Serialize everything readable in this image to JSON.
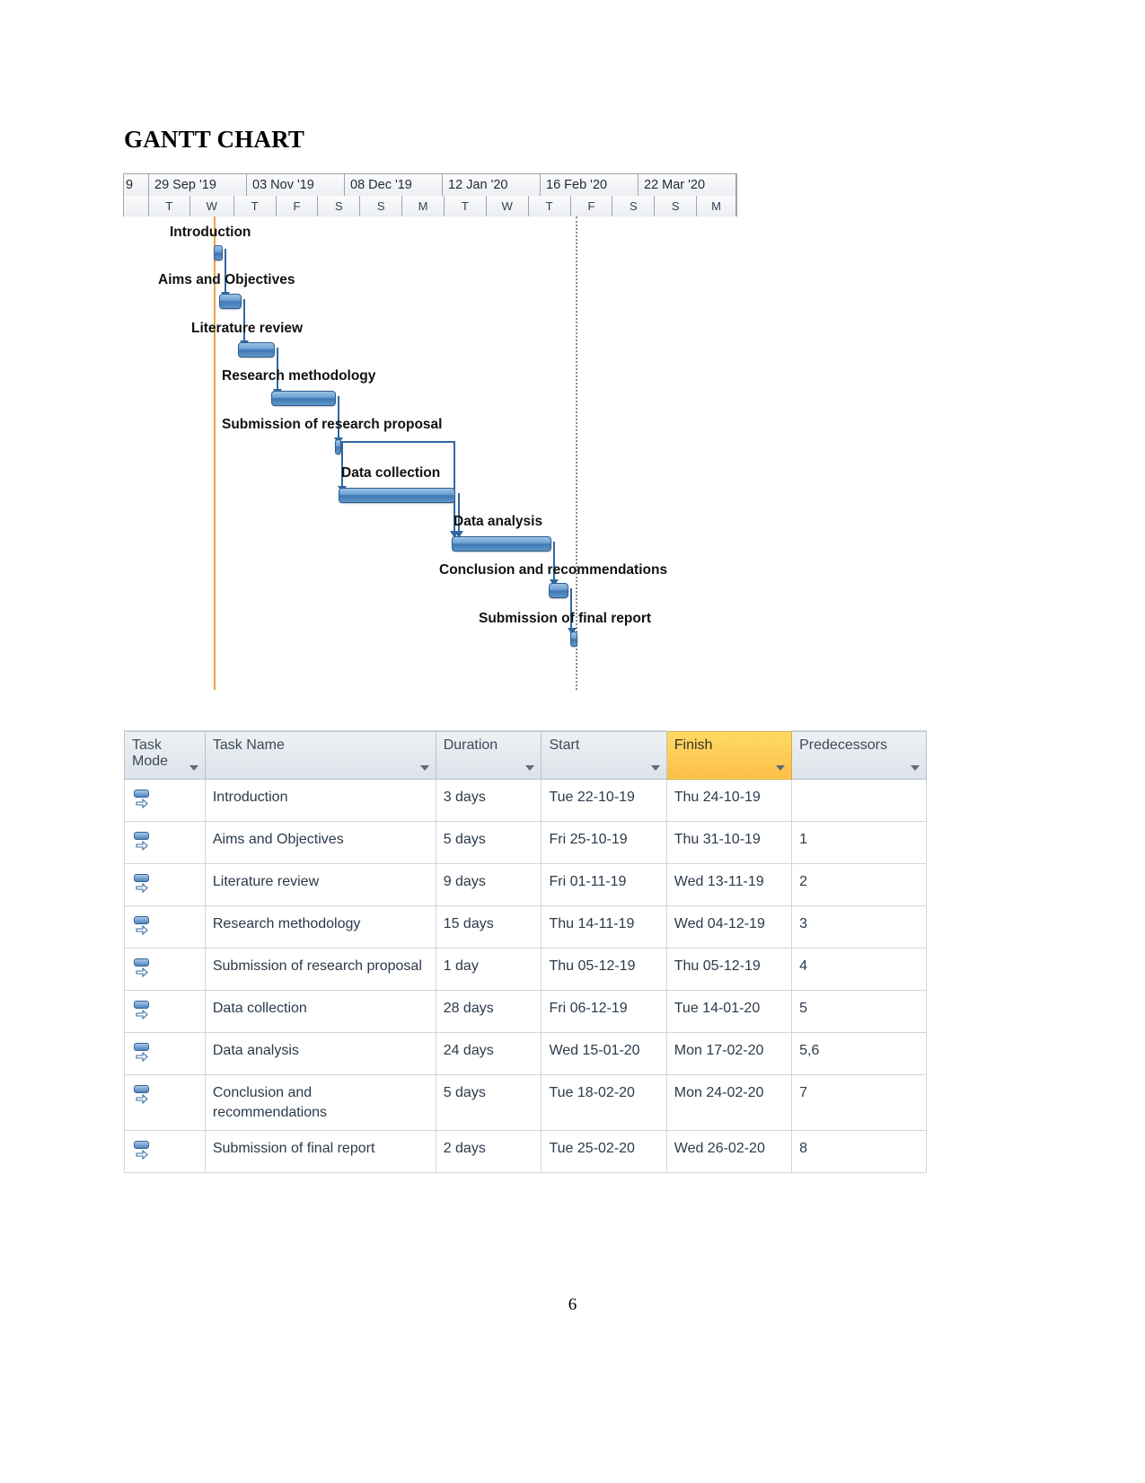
{
  "document": {
    "title": "GANTT CHART",
    "page_number": "6"
  },
  "gantt": {
    "timeline": {
      "period_labels": [
        "9",
        "29 Sep '19",
        "03 Nov '19",
        "08 Dec '19",
        "12 Jan '20",
        "16 Feb '20",
        "22 Mar '20"
      ],
      "day_labels": [
        "",
        "T",
        "W",
        "T",
        "F",
        "S",
        "S",
        "M",
        "T",
        "W",
        "T",
        "F",
        "S",
        "S",
        "M"
      ]
    },
    "bars": [
      {
        "label": "Introduction",
        "duration": "3 days"
      },
      {
        "label": "Aims and Objectives",
        "duration": "5 days"
      },
      {
        "label": "Literature review",
        "duration": "9 days"
      },
      {
        "label": "Research methodology",
        "duration": "15 days"
      },
      {
        "label": "Submission of research proposal",
        "duration": "1 day"
      },
      {
        "label": "Data collection",
        "duration": "28 days"
      },
      {
        "label": "Data analysis",
        "duration": "24 days"
      },
      {
        "label": "Conclusion and recommendations",
        "duration": "5 days"
      },
      {
        "label": "Submission of final report",
        "duration": "2 days"
      }
    ]
  },
  "table": {
    "headers": {
      "mode": "Task Mode",
      "name": "Task Name",
      "duration": "Duration",
      "start": "Start",
      "finish": "Finish",
      "predecessors": "Predecessors"
    },
    "rows": [
      {
        "mode_icon": "manually-scheduled-icon",
        "name": "Introduction",
        "duration": "3 days",
        "start": "Tue 22-10-19",
        "finish": "Thu 24-10-19",
        "predecessors": ""
      },
      {
        "mode_icon": "manually-scheduled-icon",
        "name": "Aims and Objectives",
        "duration": "5 days",
        "start": "Fri 25-10-19",
        "finish": "Thu 31-10-19",
        "predecessors": "1"
      },
      {
        "mode_icon": "manually-scheduled-icon",
        "name": "Literature review",
        "duration": "9 days",
        "start": "Fri 01-11-19",
        "finish": "Wed 13-11-19",
        "predecessors": "2"
      },
      {
        "mode_icon": "manually-scheduled-icon",
        "name": "Research methodology",
        "duration": "15 days",
        "start": "Thu 14-11-19",
        "finish": "Wed 04-12-19",
        "predecessors": "3"
      },
      {
        "mode_icon": "manually-scheduled-icon",
        "name": "Submission of research proposal",
        "duration": "1 day",
        "start": "Thu 05-12-19",
        "finish": "Thu 05-12-19",
        "predecessors": "4"
      },
      {
        "mode_icon": "manually-scheduled-icon",
        "name": "Data collection",
        "duration": "28 days",
        "start": "Fri 06-12-19",
        "finish": "Tue 14-01-20",
        "predecessors": "5"
      },
      {
        "mode_icon": "manually-scheduled-icon",
        "name": "Data analysis",
        "duration": "24 days",
        "start": "Wed 15-01-20",
        "finish": "Mon 17-02-20",
        "predecessors": "5,6"
      },
      {
        "mode_icon": "manually-scheduled-icon",
        "name": "Conclusion and recommendations",
        "duration": "5 days",
        "start": "Tue 18-02-20",
        "finish": "Mon 24-02-20",
        "predecessors": "7"
      },
      {
        "mode_icon": "manually-scheduled-icon",
        "name": "Submission of final report",
        "duration": "2 days",
        "start": "Tue 25-02-20",
        "finish": "Wed 26-02-20",
        "predecessors": "8"
      }
    ]
  },
  "colors": {
    "bar_fill": "#5e95c9",
    "bar_border": "#2e5d8f",
    "finish_highlight": "#fcbf49",
    "status_line": "#e8932c",
    "header_bg": "#dde3ea"
  },
  "chart_data": {
    "type": "bar",
    "title": "GANTT CHART",
    "xlabel": "",
    "ylabel": "",
    "categories": [
      "Introduction",
      "Aims and Objectives",
      "Literature review",
      "Research methodology",
      "Submission of research proposal",
      "Data collection",
      "Data analysis",
      "Conclusion and recommendations",
      "Submission of final report"
    ],
    "series": [
      {
        "name": "Duration (days)",
        "values": [
          3,
          5,
          9,
          15,
          1,
          28,
          24,
          5,
          2
        ]
      }
    ],
    "start_dates": [
      "Tue 22-10-19",
      "Fri 25-10-19",
      "Fri 01-11-19",
      "Thu 14-11-19",
      "Thu 05-12-19",
      "Fri 06-12-19",
      "Wed 15-01-20",
      "Tue 18-02-20",
      "Tue 25-02-20"
    ],
    "finish_dates": [
      "Thu 24-10-19",
      "Thu 31-10-19",
      "Wed 13-11-19",
      "Wed 04-12-19",
      "Thu 05-12-19",
      "Tue 14-01-20",
      "Mon 17-02-20",
      "Mon 24-02-20",
      "Wed 26-02-20"
    ],
    "predecessors": [
      "",
      "1",
      "2",
      "3",
      "4",
      "5",
      "5,6",
      "7",
      "8"
    ],
    "axis_ticks": [
      "29 Sep '19",
      "03 Nov '19",
      "08 Dec '19",
      "12 Jan '20",
      "16 Feb '20",
      "22 Mar '20"
    ],
    "grid": true,
    "legend": "none"
  }
}
